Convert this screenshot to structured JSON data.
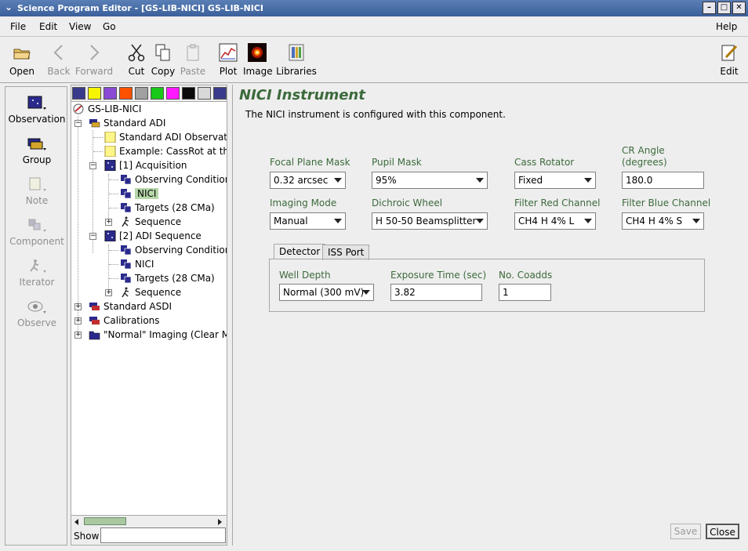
{
  "window": {
    "title": "Science Program Editor - [GS-LIB-NICI] GS-LIB-NICI"
  },
  "menu": {
    "file": "File",
    "edit": "Edit",
    "view": "View",
    "go": "Go",
    "help": "Help"
  },
  "toolbar": {
    "open": "Open",
    "back": "Back",
    "forward": "Forward",
    "cut": "Cut",
    "copy": "Copy",
    "paste": "Paste",
    "plot": "Plot",
    "image": "Image",
    "libraries": "Libraries",
    "edit": "Edit"
  },
  "palette": {
    "observation": "Observation",
    "group": "Group",
    "note": "Note",
    "component": "Component",
    "iterator": "Iterator",
    "observe": "Observe"
  },
  "tree": {
    "root": "GS-LIB-NICI",
    "standard_adi": "Standard ADI",
    "std_adi_obs": "Standard ADI Observati",
    "example": "Example: CassRot at th",
    "acquisition": "[1] Acquisition",
    "obs_cond_1": "Observing Condition",
    "nici_1": "NICI",
    "targets_1": "Targets (28 CMa)",
    "sequence_1": "Sequence",
    "adi_sequence": "[2] ADI Sequence",
    "obs_cond_2": "Observing Condition",
    "nici_2": "NICI",
    "targets_2": "Targets (28 CMa)",
    "sequence_2": "Sequence",
    "standard_asdi": "Standard ASDI",
    "calibrations": "Calibrations",
    "normal_imaging": "\"Normal\" Imaging (Clear Ma",
    "show_label": "Show",
    "show_value": ""
  },
  "colors": {
    "swatches": [
      "#3a3a8c",
      "#f5f500",
      "#8a4ad6",
      "#ff5000",
      "#a0a0a0",
      "#19c819",
      "#ff19ff",
      "#0a0a0a",
      "#d8d8d8",
      "#3a3a8c"
    ],
    "accent_green": "#3c6a3c"
  },
  "main": {
    "title": "NICI Instrument",
    "description": "The NICI instrument is configured with this component.",
    "focal_plane_mask_label": "Focal Plane Mask",
    "focal_plane_mask_value": "0.32 arcsec",
    "pupil_mask_label": "Pupil Mask",
    "pupil_mask_value": "95%",
    "cass_rotator_label": "Cass Rotator",
    "cass_rotator_value": "Fixed",
    "cr_angle_label_1": "CR Angle",
    "cr_angle_label_2": "(degrees)",
    "cr_angle_value": "180.0",
    "imaging_mode_label": "Imaging Mode",
    "imaging_mode_value": "Manual",
    "dichroic_wheel_label": "Dichroic Wheel",
    "dichroic_wheel_value": "H 50-50 Beamsplitter",
    "filter_red_label": "Filter Red Channel",
    "filter_red_value": "CH4 H 4% L",
    "filter_blue_label": "Filter Blue Channel",
    "filter_blue_value": "CH4 H 4% S",
    "tab_detector": "Detector",
    "tab_iss_port": "ISS Port",
    "well_depth_label": "Well Depth",
    "well_depth_value": "Normal (300 mV)",
    "exposure_time_label": "Exposure Time (sec)",
    "exposure_time_value": "3.82",
    "coadds_label": "No. Coadds",
    "coadds_value": "1",
    "save_label": "Save",
    "close_label": "Close"
  }
}
